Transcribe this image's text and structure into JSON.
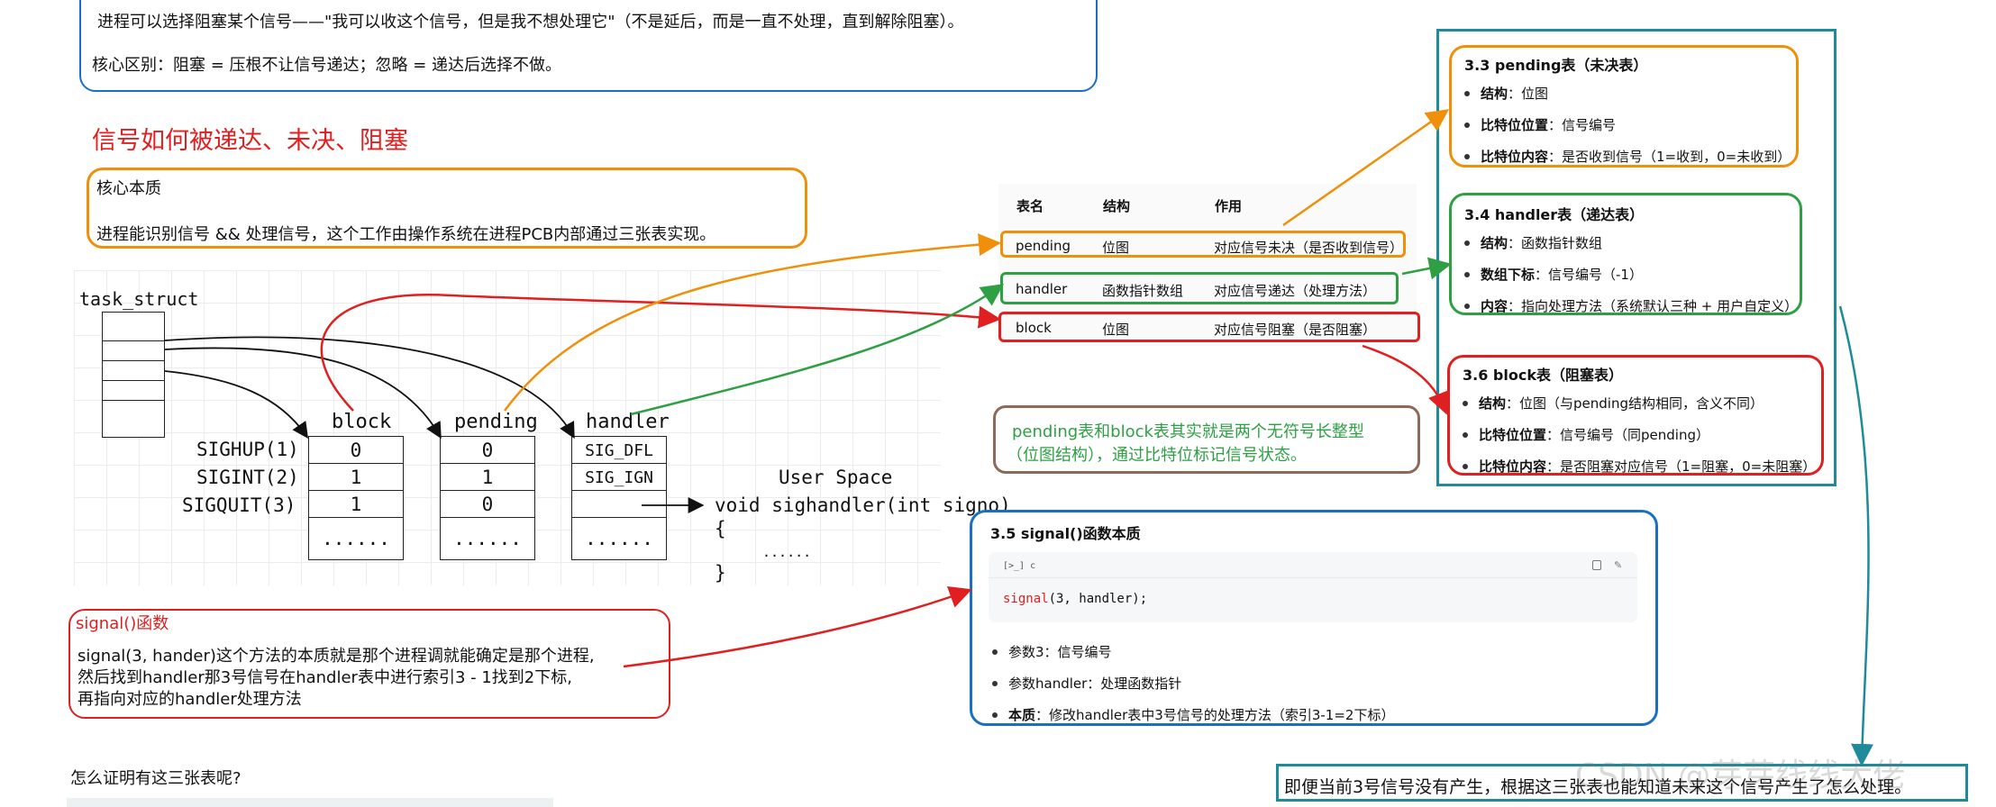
{
  "top_note": {
    "line1": "进程可以选择阻塞某个信号——\"我可以收这个信号，但是我不想处理它\"（不是延后，而是一直不处理，直到解除阻塞）。",
    "line2": "核心区别：阻塞 = 压根不让信号递达；忽略 = 递达后选择不做。"
  },
  "section_title": "信号如何被递达、未决、阻塞",
  "essence_box": {
    "title": "核心本质",
    "text": "进程能识别信号 && 处理信号，这个工作由操作系统在进程PCB内部通过三张表实现。"
  },
  "diagram": {
    "task_struct": "task_struct",
    "signal_names": [
      "SIGHUP(1)",
      "SIGINT(2)",
      "SIGQUIT(3)"
    ],
    "block": {
      "label": "block",
      "values": [
        "0",
        "1",
        "1",
        "......"
      ]
    },
    "pending": {
      "label": "pending",
      "values": [
        "0",
        "1",
        "0",
        "......"
      ]
    },
    "handler": {
      "label": "handler",
      "values": [
        "SIG_DFL",
        "SIG_IGN",
        "",
        "......"
      ]
    },
    "user_space": "User Space",
    "sighandler": {
      "line1": "void sighandler(int signo)",
      "line2": "{",
      "line3": "......",
      "line4": "}"
    }
  },
  "signal_box": {
    "title": "signal()函数",
    "text1": "signal(3, hander)这个方法的本质就是那个进程调就能确定是那个进程,",
    "text2": "然后找到handler那3号信号在handler表中进行索引3 - 1找到2下标,",
    "text3": "再指向对应的handler处理方法"
  },
  "question": "怎么证明有这三张表呢?",
  "table": {
    "headers": [
      "表名",
      "结构",
      "作用"
    ],
    "rows": [
      {
        "name": "pending",
        "struct": "位图",
        "role": "对应信号未决（是否收到信号）"
      },
      {
        "name": "handler",
        "struct": "函数指针数组",
        "role": "对应信号递达（处理方法）"
      },
      {
        "name": "block",
        "struct": "位图",
        "role": "对应信号阻塞（是否阻塞）"
      }
    ]
  },
  "bitmap_note": {
    "line1": "pending表和block表其实就是两个无符号长整型",
    "line2": "（位图结构），通过比特位标记信号状态。"
  },
  "pending_card": {
    "title": "3.3 pending表（未决表）",
    "items": [
      {
        "k": "结构",
        "v": "：位图"
      },
      {
        "k": "比特位位置",
        "v": "：信号编号"
      },
      {
        "k": "比特位内容",
        "v": "：是否收到信号（1=收到，0=未收到）"
      }
    ]
  },
  "handler_card": {
    "title": "3.4 handler表（递达表）",
    "items": [
      {
        "k": "结构",
        "v": "：函数指针数组"
      },
      {
        "k": "数组下标",
        "v": "：信号编号（-1）"
      },
      {
        "k": "内容",
        "v": "：指向处理方法（系统默认三种 + 用户自定义）"
      }
    ]
  },
  "block_card": {
    "title": "3.6 block表（阻塞表）",
    "items": [
      {
        "k": "结构",
        "v": "：位图（与pending结构相同，含义不同）"
      },
      {
        "k": "比特位位置",
        "v": "：信号编号（同pending）"
      },
      {
        "k": "比特位内容",
        "v": "：是否阻塞对应信号（1=阻塞，0=未阻塞）"
      }
    ]
  },
  "signal_card": {
    "title": "3.5 signal()函数本质",
    "code_lang": "c",
    "code_fn": "signal",
    "code_args": "(3, handler);",
    "items": [
      {
        "k": "",
        "v": "参数3：信号编号"
      },
      {
        "k": "",
        "v": "参数handler：处理函数指针"
      },
      {
        "k": "本质",
        "v": "：修改handler表中3号信号的处理方法（索引3-1=2下标）"
      }
    ]
  },
  "bottom_note": "即便当前3号信号没有产生，根据这三张表也能知道未来这个信号产生了怎么处理。",
  "watermark": "CSDN @芽芽线线大佬",
  "colors": {
    "red": "#e02020",
    "orange": "#f0900a",
    "green": "#2ea043",
    "blue": "#1a6fc4",
    "teal": "#1f8a99",
    "brown": "#8b6a5a"
  }
}
